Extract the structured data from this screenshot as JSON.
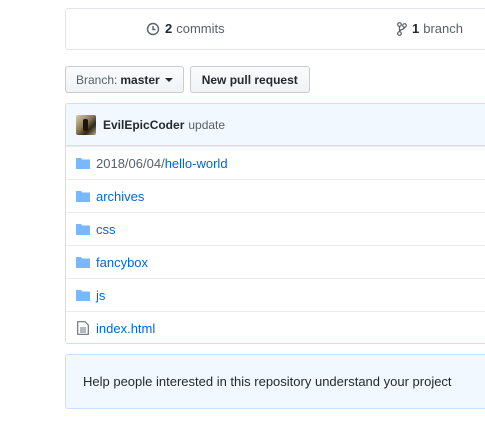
{
  "summary": {
    "commits_count": "2",
    "commits_label": "commits",
    "branch_count": "1",
    "branch_label": "branch"
  },
  "toolbar": {
    "branch_prefix": "Branch:",
    "branch_name": "master",
    "new_pr_label": "New pull request"
  },
  "commit": {
    "author": "EvilEpicCoder",
    "message": "update"
  },
  "files": [
    {
      "prefix": "2018/06/04/",
      "name": "hello-world",
      "type": "folder"
    },
    {
      "prefix": "",
      "name": "archives",
      "type": "folder"
    },
    {
      "prefix": "",
      "name": "css",
      "type": "folder"
    },
    {
      "prefix": "",
      "name": "fancybox",
      "type": "folder"
    },
    {
      "prefix": "",
      "name": "js",
      "type": "folder"
    },
    {
      "prefix": "",
      "name": "index.html",
      "type": "file"
    }
  ],
  "readme_hint": "Help people interested in this repository understand your project",
  "colors": {
    "link": "#0366d6",
    "folder_icon": "#79b8ff",
    "hint_bg": "#f1f8ff"
  },
  "icons": {
    "commits": "history-icon",
    "branch": "git-branch-icon",
    "folder": "folder-icon",
    "file": "file-icon"
  }
}
